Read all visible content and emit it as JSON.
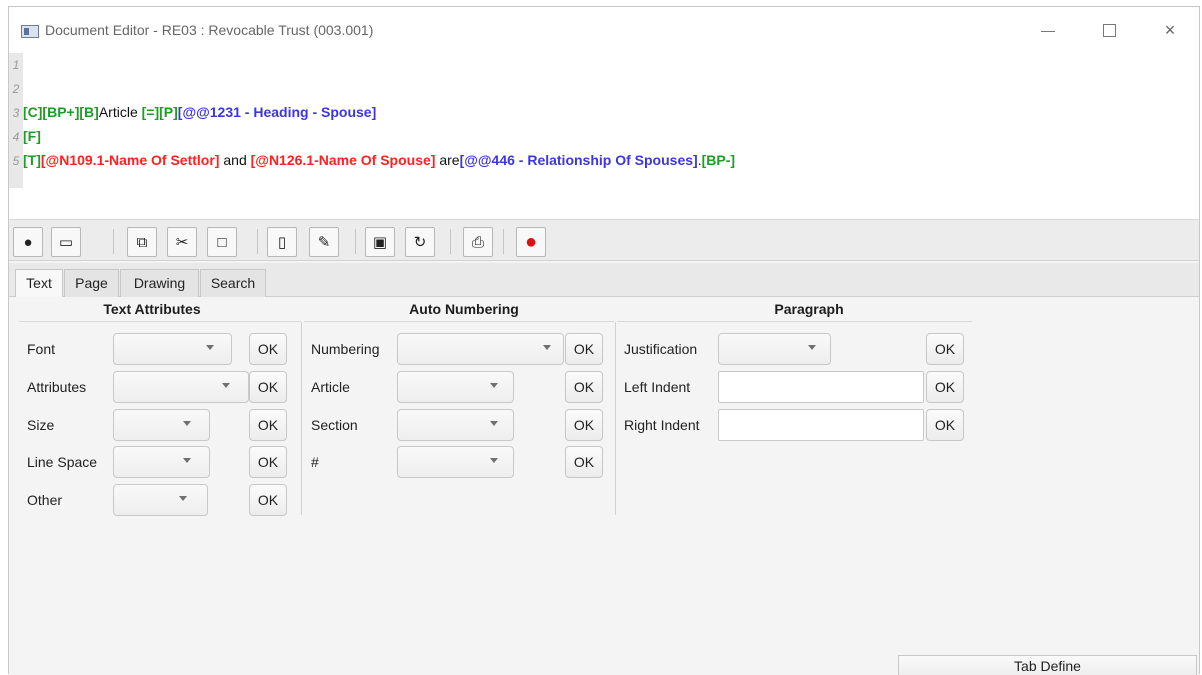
{
  "window": {
    "title": "Document Editor - RE03 : Revocable Trust (003.001)",
    "controls": {
      "minimize": "minimize",
      "maximize": "maximize",
      "close": "×"
    }
  },
  "editor": {
    "line_numbers": [
      "1",
      "2",
      "3",
      "4",
      "5"
    ],
    "lines": [
      [],
      [],
      [
        {
          "text": "[C][BP+][B]",
          "style": "green"
        },
        {
          "text": "Article ",
          "style": "black"
        },
        {
          "text": "[=][P]",
          "style": "green"
        },
        {
          "text": "[@@1231 - Heading - Spouse]",
          "style": "blue"
        }
      ],
      [
        {
          "text": "[F]",
          "style": "green"
        }
      ],
      [
        {
          "text": "[T]",
          "style": "green"
        },
        {
          "text": "[@N109.1-Name Of Settlor]",
          "style": "red"
        },
        {
          "text": " and ",
          "style": "black"
        },
        {
          "text": "[@N126.1-Name Of Spouse]",
          "style": "red"
        },
        {
          "text": " are",
          "style": "black"
        },
        {
          "text": "[@@446 - Relationship Of Spouses]",
          "style": "blue"
        },
        {
          "text": ".",
          "style": "black"
        },
        {
          "text": "[BP-]",
          "style": "green"
        }
      ]
    ]
  },
  "toolbar": {
    "buttons": [
      {
        "name": "database-icon",
        "glyph": "●"
      },
      {
        "name": "computer-icon",
        "glyph": "▭"
      },
      {
        "name": "copy-icon",
        "glyph": "⧉"
      },
      {
        "name": "cut-icon",
        "glyph": "✂"
      },
      {
        "name": "paste-icon",
        "glyph": "□"
      },
      {
        "name": "new-document-icon",
        "glyph": "▯"
      },
      {
        "name": "edit-icon",
        "glyph": "✎"
      },
      {
        "name": "save-icon",
        "glyph": "▣"
      },
      {
        "name": "refresh-icon",
        "glyph": "↻"
      },
      {
        "name": "print-icon",
        "glyph": "⎙"
      },
      {
        "name": "record-icon",
        "glyph": "●"
      }
    ]
  },
  "tabs": [
    "Text",
    "Page",
    "Drawing",
    "Search"
  ],
  "active_tab": "Text",
  "sections": {
    "text_attributes": {
      "title": "Text Attributes",
      "rows": [
        "Font",
        "Attributes",
        "Size",
        "Line Space",
        "Other"
      ]
    },
    "auto_numbering": {
      "title": "Auto Numbering",
      "rows": [
        "Numbering",
        "Article",
        "Section",
        "#"
      ]
    },
    "paragraph": {
      "title": "Paragraph",
      "rows": [
        "Justification",
        "Left Indent",
        "Right Indent"
      ]
    }
  },
  "ok_label": "OK",
  "footer": {
    "tab_define": "Tab Define"
  },
  "colors": {
    "green": "#1e9c25",
    "blue": "#3c35e3",
    "red": "#ff2020",
    "record": "#dd1111"
  }
}
